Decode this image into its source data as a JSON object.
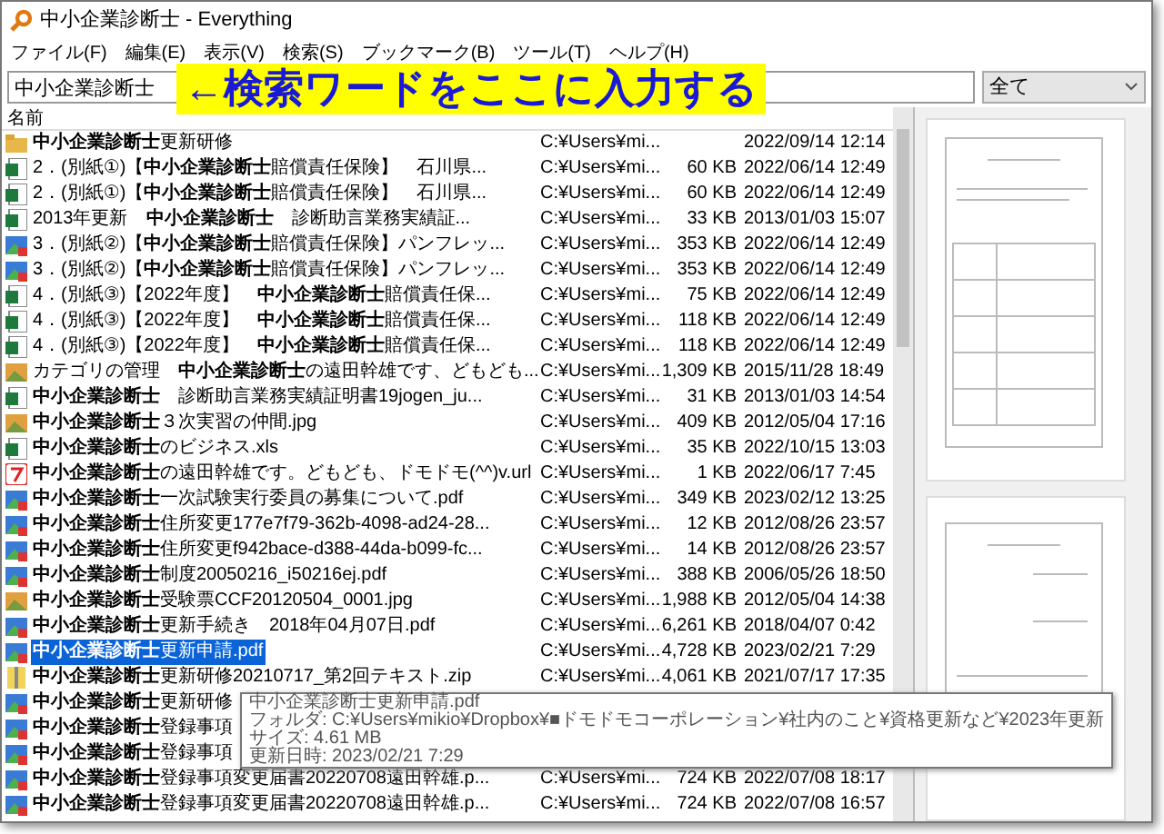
{
  "window": {
    "title": "中小企業診断士 - Everything"
  },
  "menu": [
    "ファイル(F)",
    "編集(E)",
    "表示(V)",
    "検索(S)",
    "ブックマーク(B)",
    "ツール(T)",
    "ヘルプ(H)"
  ],
  "search": {
    "value": "中小企業診断士",
    "filter": "全て"
  },
  "annotation": "←検索ワードをここに入力する",
  "columns": [
    "名前"
  ],
  "rows": [
    {
      "kind": "folder",
      "name": "**中小企業診断士**更新研修",
      "path": "C:¥Users¥mi...",
      "date": "2022/09/14 12:14",
      "selected": false
    },
    {
      "kind": "excel",
      "name": "2．(別紙①)【**中小企業診断士**賠償責任保険】　石川県...",
      "path": "C:¥Users¥mi...",
      "size": "60 KB",
      "date": "2022/06/14 12:49",
      "selected": false
    },
    {
      "kind": "excel",
      "name": "2．(別紙①)【**中小企業診断士**賠償責任保険】　石川県...",
      "path": "C:¥Users¥mi...",
      "size": "60 KB",
      "date": "2022/06/14 12:49",
      "selected": false
    },
    {
      "kind": "excel",
      "name": "2013年更新　**中小企業診断士**　診断助言業務実績証...",
      "path": "C:¥Users¥mi...",
      "size": "33 KB",
      "date": "2013/01/03 15:07",
      "selected": false
    },
    {
      "kind": "pdf",
      "name": "3．(別紙②)【**中小企業診断士**賠償責任保険】パンフレッ...",
      "path": "C:¥Users¥mi...",
      "size": "353 KB",
      "date": "2022/06/14 12:49",
      "selected": false
    },
    {
      "kind": "pdf",
      "name": "3．(別紙②)【**中小企業診断士**賠償責任保険】パンフレッ...",
      "path": "C:¥Users¥mi...",
      "size": "353 KB",
      "date": "2022/06/14 12:49",
      "selected": false
    },
    {
      "kind": "excel",
      "name": "4．(別紙③)【2022年度】　**中小企業診断士**賠償責任保...",
      "path": "C:¥Users¥mi...",
      "size": "75 KB",
      "date": "2022/06/14 12:49",
      "selected": false
    },
    {
      "kind": "excel",
      "name": "4．(別紙③)【2022年度】　**中小企業診断士**賠償責任保...",
      "path": "C:¥Users¥mi...",
      "size": "118 KB",
      "date": "2022/06/14 12:49",
      "selected": false
    },
    {
      "kind": "excel",
      "name": "4．(別紙③)【2022年度】　**中小企業診断士**賠償責任保...",
      "path": "C:¥Users¥mi...",
      "size": "118 KB",
      "date": "2022/06/14 12:49",
      "selected": false
    },
    {
      "kind": "image",
      "name": "カテゴリの管理　**中小企業診断士**の遠田幹雄です、どもども...",
      "path": "C:¥Users¥mi...",
      "size": "1,309 KB",
      "date": "2015/11/28 18:49",
      "selected": false
    },
    {
      "kind": "excel",
      "name": "**中小企業診断士**　診断助言業務実績証明書19jogen_ju...",
      "path": "C:¥Users¥mi...",
      "size": "31 KB",
      "date": "2013/01/03 14:54",
      "selected": false
    },
    {
      "kind": "image",
      "name": "**中小企業診断士**３次実習の仲間.jpg",
      "path": "C:¥Users¥mi...",
      "size": "409 KB",
      "date": "2012/05/04 17:16",
      "selected": false
    },
    {
      "kind": "excel",
      "name": "**中小企業診断士**のビジネス.xls",
      "path": "C:¥Users¥mi...",
      "size": "35 KB",
      "date": "2022/10/15 13:03",
      "selected": false
    },
    {
      "kind": "url",
      "name": "**中小企業診断士**の遠田幹雄です。どもども、ドモドモ(^^)v.url",
      "path": "C:¥Users¥mi...",
      "size": "1 KB",
      "date": "2022/06/17 7:45",
      "selected": false
    },
    {
      "kind": "pdf",
      "name": "**中小企業診断士**一次試験実行委員の募集について.pdf",
      "path": "C:¥Users¥mi...",
      "size": "349 KB",
      "date": "2023/02/12 13:25",
      "selected": false
    },
    {
      "kind": "pdf",
      "name": "**中小企業診断士**住所変更177e7f79-362b-4098-ad24-28...",
      "path": "C:¥Users¥mi...",
      "size": "12 KB",
      "date": "2012/08/26 23:57",
      "selected": false
    },
    {
      "kind": "pdf",
      "name": "**中小企業診断士**住所変更f942bace-d388-44da-b099-fc...",
      "path": "C:¥Users¥mi...",
      "size": "14 KB",
      "date": "2012/08/26 23:57",
      "selected": false
    },
    {
      "kind": "pdf",
      "name": "**中小企業診断士**制度20050216_i50216ej.pdf",
      "path": "C:¥Users¥mi...",
      "size": "388 KB",
      "date": "2006/05/26 18:50",
      "selected": false
    },
    {
      "kind": "image",
      "name": "**中小企業診断士**受験票CCF20120504_0001.jpg",
      "path": "C:¥Users¥mi...",
      "size": "1,988 KB",
      "date": "2012/05/04 14:38",
      "selected": false
    },
    {
      "kind": "pdf",
      "name": "**中小企業診断士**更新手続き　2018年04月07日.pdf",
      "path": "C:¥Users¥mi...",
      "size": "6,261 KB",
      "date": "2018/04/07 0:42",
      "selected": false
    },
    {
      "kind": "pdf",
      "name": "**中小企業診断士**更新申請.pdf",
      "path": "C:¥Users¥mi...",
      "size": "4,728 KB",
      "date": "2023/02/21 7:29",
      "selected": true
    },
    {
      "kind": "zip",
      "name": "**中小企業診断士**更新研修20210717_第2回テキスト.zip",
      "path": "C:¥Users¥mi...",
      "size": "4,061 KB",
      "date": "2021/07/17 17:35",
      "selected": false
    },
    {
      "kind": "pdf",
      "name": "**中小企業診断士**更新研修",
      "selected": false
    },
    {
      "kind": "pdf",
      "name": "**中小企業診断士**登録事項",
      "selected": false
    },
    {
      "kind": "pdf",
      "name": "**中小企業診断士**登録事項",
      "selected": false
    },
    {
      "kind": "pdf",
      "name": "**中小企業診断士**登録事項変更届書20220708遠田幹雄.p...",
      "path": "C:¥Users¥mi...",
      "size": "724 KB",
      "date": "2022/07/08 18:17",
      "selected": false
    },
    {
      "kind": "pdf",
      "name": "**中小企業診断士**登録事項変更届書20220708遠田幹雄.p...",
      "path": "C:¥Users¥mi...",
      "size": "724 KB",
      "date": "2022/07/08 16:57",
      "selected": false
    }
  ],
  "tooltip": [
    "中小企業診断士更新申請.pdf",
    "フォルダ: C:¥Users¥mikio¥Dropbox¥■ドモドモコーポレーション¥社内のこと¥資格更新など¥2023年更新",
    "サイズ: 4.61 MB",
    "更新日時: 2023/02/21 7:29"
  ]
}
